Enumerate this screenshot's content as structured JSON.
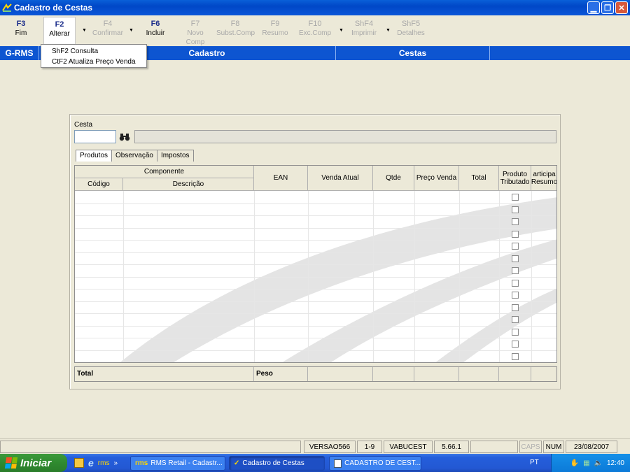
{
  "window": {
    "title": "Cadastro de Cestas"
  },
  "toolbar": [
    {
      "key": "F3",
      "label": "Fim",
      "enabled": true
    },
    {
      "key": "F2",
      "label": "Alterar",
      "enabled": true
    },
    {
      "key": "F4",
      "label": "Confirmar",
      "enabled": false
    },
    {
      "key": "F6",
      "label": "Incluir",
      "enabled": true
    },
    {
      "key": "F7",
      "label": "Novo Comp",
      "enabled": false
    },
    {
      "key": "F8",
      "label": "Subst.Comp",
      "enabled": false
    },
    {
      "key": "F9",
      "label": "Resumo",
      "enabled": false
    },
    {
      "key": "F10",
      "label": "Exc.Comp",
      "enabled": false
    },
    {
      "key": "ShF4",
      "label": "Imprimir",
      "enabled": false
    },
    {
      "key": "ShF5",
      "label": "Detalhes",
      "enabled": false
    }
  ],
  "strip": {
    "app": "G-RMS",
    "module": "Cadastro",
    "screen": "Cestas"
  },
  "menu": [
    {
      "label": "ShF2  Consulta"
    },
    {
      "label": "CtF2  Atualiza Preço Venda"
    }
  ],
  "form": {
    "cesta_label": "Cesta",
    "cesta_value": "",
    "cesta_description": ""
  },
  "tabs": [
    {
      "label": "Produtos",
      "active": true
    },
    {
      "label": "Observação",
      "active": false
    },
    {
      "label": "Impostos",
      "active": false
    }
  ],
  "grid": {
    "group_header": "Componente",
    "columns": {
      "codigo": "Código",
      "descricao": "Descrição",
      "ean": "EAN",
      "venda_atual": "Venda Atual",
      "qtde": "Qtde",
      "preco_venda": "Preço Venda",
      "total": "Total",
      "produto_tributado_1": "Produto",
      "produto_tributado_2": "Tributado",
      "participa_1": "articipa",
      "participa_2": "Resumo"
    },
    "row_count": 14
  },
  "totals": {
    "total_label": "Total",
    "peso_label": "Peso"
  },
  "statusbar": {
    "version": "VERSAO566",
    "page": "1-9",
    "program": "VABUCEST",
    "build": "5.66.1",
    "caps": "CAPS",
    "num": "NUM",
    "date": "23/08/2007"
  },
  "taskbar": {
    "start_label": "Iniciar",
    "tasks": [
      {
        "label": "RMS Retail - Cadastr...",
        "active": false
      },
      {
        "label": "Cadastro de Cestas",
        "active": true
      },
      {
        "label": "CADASTRO DE CEST...",
        "active": false
      }
    ],
    "language": "PT",
    "clock": "12:40"
  }
}
